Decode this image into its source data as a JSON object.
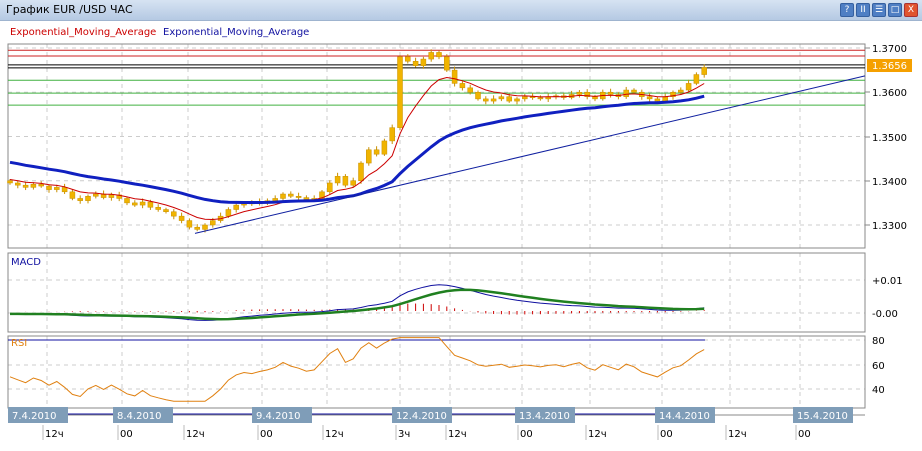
{
  "window": {
    "title": "График EUR /USD  ЧАС",
    "buttons": [
      "?",
      "II",
      "☰",
      "□",
      "X"
    ]
  },
  "legend": [
    {
      "label": "Exponential_Moving_Average",
      "color": "#cc0000"
    },
    {
      "label": "Exponential_Moving_Average",
      "color": "#1010a0"
    }
  ],
  "colors": {
    "candle": "#f0b400",
    "ema_fast": "#cc0000",
    "ema_slow": "#1020c0",
    "macd": "#1010a0",
    "signal": "#208020",
    "hist": "#cc0000",
    "rsi": "#e08010",
    "price_tag": "#f5a000",
    "date_box": "#7f9db8"
  },
  "chart_data": [
    {
      "type": "candlestick",
      "symbol": "EUR/USD",
      "timeframe": "ЧАС",
      "ylim": [
        1.326,
        1.372
      ],
      "yticks": [
        "1.3700",
        "1.3600",
        "1.3500",
        "1.3400",
        "1.3300"
      ],
      "last_price": "1.3656",
      "closes": [
        1.3395,
        1.339,
        1.3385,
        1.3392,
        1.3388,
        1.338,
        1.3385,
        1.3375,
        1.336,
        1.3355,
        1.3365,
        1.337,
        1.3362,
        1.3368,
        1.336,
        1.335,
        1.3345,
        1.3352,
        1.334,
        1.3335,
        1.333,
        1.332,
        1.331,
        1.3295,
        1.329,
        1.33,
        1.331,
        1.332,
        1.3335,
        1.3345,
        1.335,
        1.3348,
        1.3352,
        1.3355,
        1.336,
        1.337,
        1.3365,
        1.3362,
        1.3358,
        1.336,
        1.3375,
        1.3395,
        1.341,
        1.339,
        1.34,
        1.344,
        1.347,
        1.346,
        1.349,
        1.352,
        1.368,
        1.367,
        1.366,
        1.3675,
        1.369,
        1.368,
        1.365,
        1.362,
        1.361,
        1.36,
        1.3585,
        1.358,
        1.3585,
        1.359,
        1.358,
        1.3585,
        1.359,
        1.3588,
        1.3585,
        1.359,
        1.3592,
        1.3588,
        1.3595,
        1.36,
        1.359,
        1.3585,
        1.36,
        1.3595,
        1.359,
        1.3605,
        1.36,
        1.359,
        1.3585,
        1.358,
        1.359,
        1.36,
        1.3605,
        1.362,
        1.364,
        1.3656
      ],
      "levels": [
        {
          "value": 1.3695,
          "color": "#cc2222"
        },
        {
          "value": 1.3682,
          "color": "#cc2222"
        },
        {
          "value": 1.3662,
          "color": "#000000"
        },
        {
          "value": 1.3655,
          "color": "#000000"
        },
        {
          "value": 1.3627,
          "color": "#40b040"
        },
        {
          "value": 1.3598,
          "color": "#40b040"
        },
        {
          "value": 1.3571,
          "color": "#40b040"
        }
      ],
      "trendline": [
        1.3281,
        1.3637
      ]
    },
    {
      "type": "line",
      "name": "MACD",
      "yticks": [
        "+0.01",
        "-0.00"
      ]
    },
    {
      "type": "line",
      "name": "RSI",
      "yticks": [
        "80",
        "60",
        "40"
      ],
      "level": 80
    }
  ],
  "time_axis": {
    "dates": [
      "7.4.2010",
      "8.4.2010",
      "9.4.2010",
      "12.4.2010",
      "13.4.2010",
      "14.4.2010",
      "15.4.2010"
    ],
    "hours": [
      "12ч",
      "00",
      "12ч",
      "00",
      "12ч",
      "3ч",
      "12ч",
      "00",
      "12ч",
      "00",
      "12ч",
      "00"
    ]
  }
}
